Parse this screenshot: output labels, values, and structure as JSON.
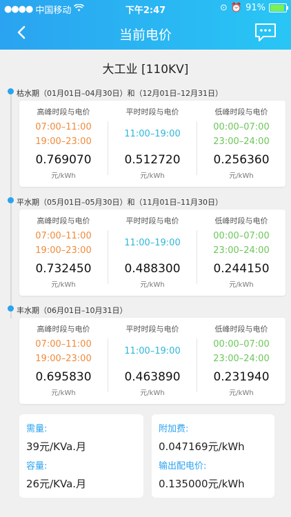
{
  "status": {
    "carrier": "中国移动",
    "time": "下午2:47",
    "battery": "91%"
  },
  "nav": {
    "title": "当前电价"
  },
  "category": "大工业 [110KV]",
  "labels": {
    "peak": "高峰时段与电价",
    "flat": "平时时段与电价",
    "valley": "低峰时段与电价",
    "unit": "元/kWh"
  },
  "seasons": [
    {
      "title": "枯水期（01月01日–04月30日）和（12月01日–12月31日）",
      "peak": {
        "t1": "07:00–11:00",
        "t2": "19:00–23:00",
        "price": "0.769070"
      },
      "flat": {
        "t1": "11:00–19:00",
        "price": "0.512720"
      },
      "valley": {
        "t1": "00:00–07:00",
        "t2": "23:00–24:00",
        "price": "0.256360"
      }
    },
    {
      "title": "平水期（05月01日–05月30日）和（11月01日–11月30日）",
      "peak": {
        "t1": "07:00–11:00",
        "t2": "19:00–23:00",
        "price": "0.732450"
      },
      "flat": {
        "t1": "11:00–19:00",
        "price": "0.488300"
      },
      "valley": {
        "t1": "00:00–07:00",
        "t2": "23:00–24:00",
        "price": "0.244150"
      }
    },
    {
      "title": "丰水期（06月01日–10月31日）",
      "peak": {
        "t1": "07:00–11:00",
        "t2": "19:00–23:00",
        "price": "0.695830"
      },
      "flat": {
        "t1": "11:00–19:00",
        "price": "0.463890"
      },
      "valley": {
        "t1": "00:00–07:00",
        "t2": "23:00–24:00",
        "price": "0.231940"
      }
    }
  ],
  "extra": {
    "demand_label": "需量:",
    "demand_value": "39元/KVa.月",
    "capacity_label": "容量:",
    "capacity_value": "26元/KVa.月",
    "surcharge_label": "附加费:",
    "surcharge_value": "0.047169元/kWh",
    "transmission_label": "输出配电价:",
    "transmission_value": "0.135000元/kWh"
  },
  "colors": {
    "accent": "#2aa3f0",
    "peak": "#f08a3a",
    "flat": "#2bb7d9",
    "valley": "#6cc65a"
  }
}
